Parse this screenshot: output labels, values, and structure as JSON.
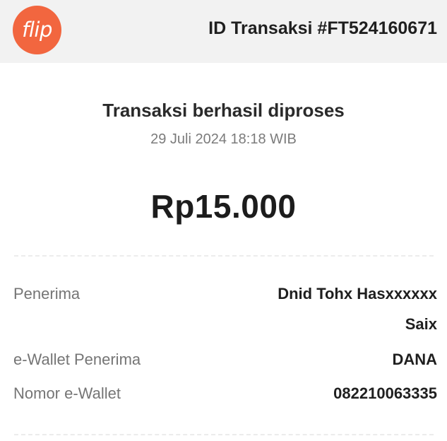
{
  "header": {
    "logo_text": "flip",
    "transaction_id": "ID Transaksi #FT524160671",
    "brand_color": "#f2663f"
  },
  "status": {
    "title": "Transaksi berhasil diproses",
    "datetime": "29 Juli 2024 18:18 WIB"
  },
  "amount": "Rp15.000",
  "details": {
    "recipient_label": "Penerima",
    "recipient_name_line1": "Dnid Tohx Hasxxxxxx",
    "recipient_name_line2": "Saix",
    "ewallet_label": "e-Wallet Penerima",
    "ewallet_value": "DANA",
    "number_label": "Nomor e-Wallet",
    "number_value": "082210063335"
  }
}
